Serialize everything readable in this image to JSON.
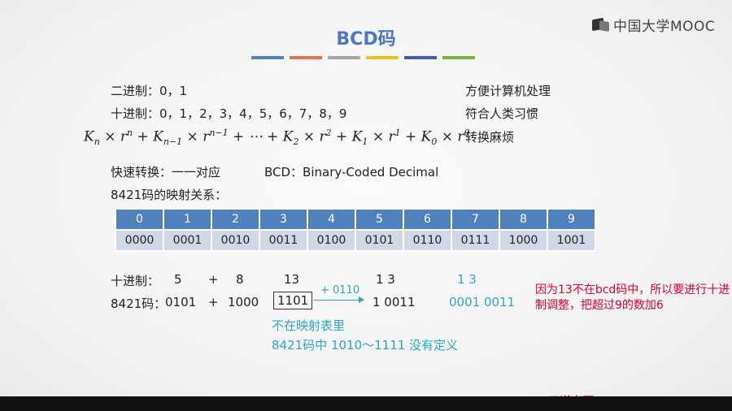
{
  "logo_text": "中国大学MOOC",
  "title": "BCD码",
  "accent_colors": [
    "#4f81bd",
    "#e0744a",
    "#a5a5a5",
    "#f0c21c",
    "#3f5fae",
    "#7cb342"
  ],
  "rows": {
    "binary": "二进制：0，1",
    "binary_note": "方便计算机处理",
    "decimal": "十进制：0，1，2，3，4，5，6，7，8，9",
    "decimal_note": "符合人类习惯",
    "formula_note": "转换麻烦"
  },
  "quick": {
    "label": "快速转换：一一对应",
    "bcd": "BCD：Binary-Coded Decimal"
  },
  "mapping_title": "8421码的映射关系：",
  "table": {
    "digits": [
      "0",
      "1",
      "2",
      "3",
      "4",
      "5",
      "6",
      "7",
      "8",
      "9"
    ],
    "codes": [
      "0000",
      "0001",
      "0010",
      "0011",
      "0100",
      "0101",
      "0110",
      "0111",
      "1000",
      "1001"
    ]
  },
  "example": {
    "dec_label": "十进制：",
    "dec_a": "5",
    "plus": "+",
    "dec_b": "8",
    "dec_sum": "13",
    "dec_result": "1   3",
    "dec_result_blue": "1     3",
    "bcd_label": "8421码：",
    "bcd_a": "0101",
    "bcd_b": "1000",
    "bcd_sum": "1101",
    "adjust": "+ 0110",
    "bcd_result": "1 0011",
    "bcd_result_blue": "0001  0011",
    "not_in_table": "不在映射表里",
    "undefined_range": "8421码中 1010～1111 没有定义"
  },
  "note_red": "因为13不在bcd码中，所以要进行十进制调整，把超过9的数加6",
  "footer": "王道考研/CSKAOYAN.COM"
}
